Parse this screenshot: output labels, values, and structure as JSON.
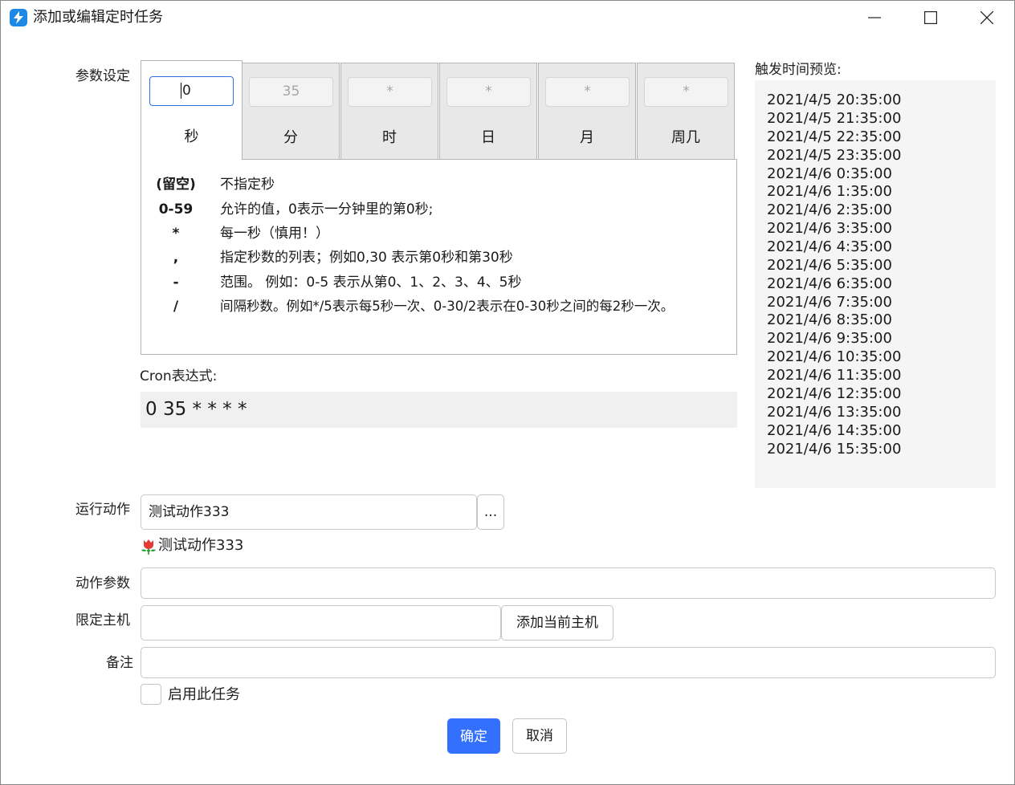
{
  "window": {
    "title": "添加或编辑定时任务"
  },
  "params": {
    "label": "参数设定",
    "tabs": [
      {
        "label": "秒",
        "value": "0",
        "active": true
      },
      {
        "label": "分",
        "value": "35"
      },
      {
        "label": "时",
        "value": "*"
      },
      {
        "label": "日",
        "value": "*"
      },
      {
        "label": "月",
        "value": "*"
      },
      {
        "label": "周几",
        "value": "*"
      }
    ],
    "rules": [
      {
        "symbol": "(留空)",
        "desc": "不指定秒"
      },
      {
        "symbol": "0-59",
        "desc": "允许的值，0表示一分钟里的第0秒;"
      },
      {
        "symbol": "*",
        "desc": "每一秒（慎用！）"
      },
      {
        "symbol": ",",
        "desc": "指定秒数的列表；例如0,30 表示第0秒和第30秒"
      },
      {
        "symbol": "-",
        "desc": "范围。 例如：0-5 表示从第0、1、2、3、4、5秒"
      },
      {
        "symbol": "/",
        "desc": "间隔秒数。例如*/5表示每5秒一次、0-30/2表示在0-30秒之间的每2秒一次。"
      }
    ]
  },
  "cron": {
    "label": "Cron表达式:",
    "expression": "0 35 * * * *"
  },
  "preview": {
    "label": "触发时间预览:",
    "times": [
      "2021/4/5 20:35:00",
      "2021/4/5 21:35:00",
      "2021/4/5 22:35:00",
      "2021/4/5 23:35:00",
      "2021/4/6 0:35:00",
      "2021/4/6 1:35:00",
      "2021/4/6 2:35:00",
      "2021/4/6 3:35:00",
      "2021/4/6 4:35:00",
      "2021/4/6 5:35:00",
      "2021/4/6 6:35:00",
      "2021/4/6 7:35:00",
      "2021/4/6 8:35:00",
      "2021/4/6 9:35:00",
      "2021/4/6 10:35:00",
      "2021/4/6 11:35:00",
      "2021/4/6 12:35:00",
      "2021/4/6 13:35:00",
      "2021/4/6 14:35:00",
      "2021/4/6 15:35:00"
    ]
  },
  "form": {
    "action_label": "运行动作",
    "action_value": "测试动作333",
    "browse_label": "...",
    "action_display": "测试动作333",
    "action_icon": "tulip-icon",
    "args_label": "动作参数",
    "args_value": "",
    "host_label": "限定主机",
    "host_value": "",
    "add_host_label": "添加当前主机",
    "note_label": "备注",
    "note_value": "",
    "enable_label": "启用此任务",
    "enable_checked": false
  },
  "buttons": {
    "ok": "确定",
    "cancel": "取消"
  },
  "colors": {
    "accent": "#3370ff",
    "app_icon": "#1e88e5"
  }
}
